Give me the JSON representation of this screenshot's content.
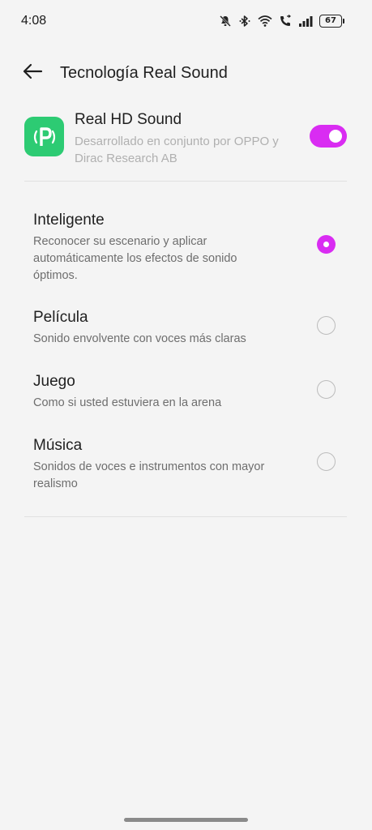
{
  "status_bar": {
    "time": "4:08",
    "battery_level": "67"
  },
  "header": {
    "title": "Tecnología Real Sound"
  },
  "hd_sound": {
    "title": "Real HD Sound",
    "description": "Desarrollado en conjunto por OPPO y Dirac Research AB",
    "enabled": true
  },
  "options": [
    {
      "title": "Inteligente",
      "description": "Reconocer su escenario y aplicar automáticamente los efectos de sonido óptimos.",
      "selected": true
    },
    {
      "title": "Película",
      "description": "Sonido envolvente con voces más claras",
      "selected": false
    },
    {
      "title": "Juego",
      "description": "Como si usted estuviera en la arena",
      "selected": false
    },
    {
      "title": "Música",
      "description": "Sonidos de voces e instrumentos con mayor realismo",
      "selected": false
    }
  ],
  "colors": {
    "accent": "#d92cf2",
    "app_icon": "#2dcb73",
    "background": "#f4f4f4"
  },
  "icons": [
    "bell-off-icon",
    "bluetooth-icon",
    "wifi-icon",
    "call-icon",
    "signal-icon",
    "battery-icon",
    "back-arrow-icon",
    "real-sound-app-icon"
  ]
}
